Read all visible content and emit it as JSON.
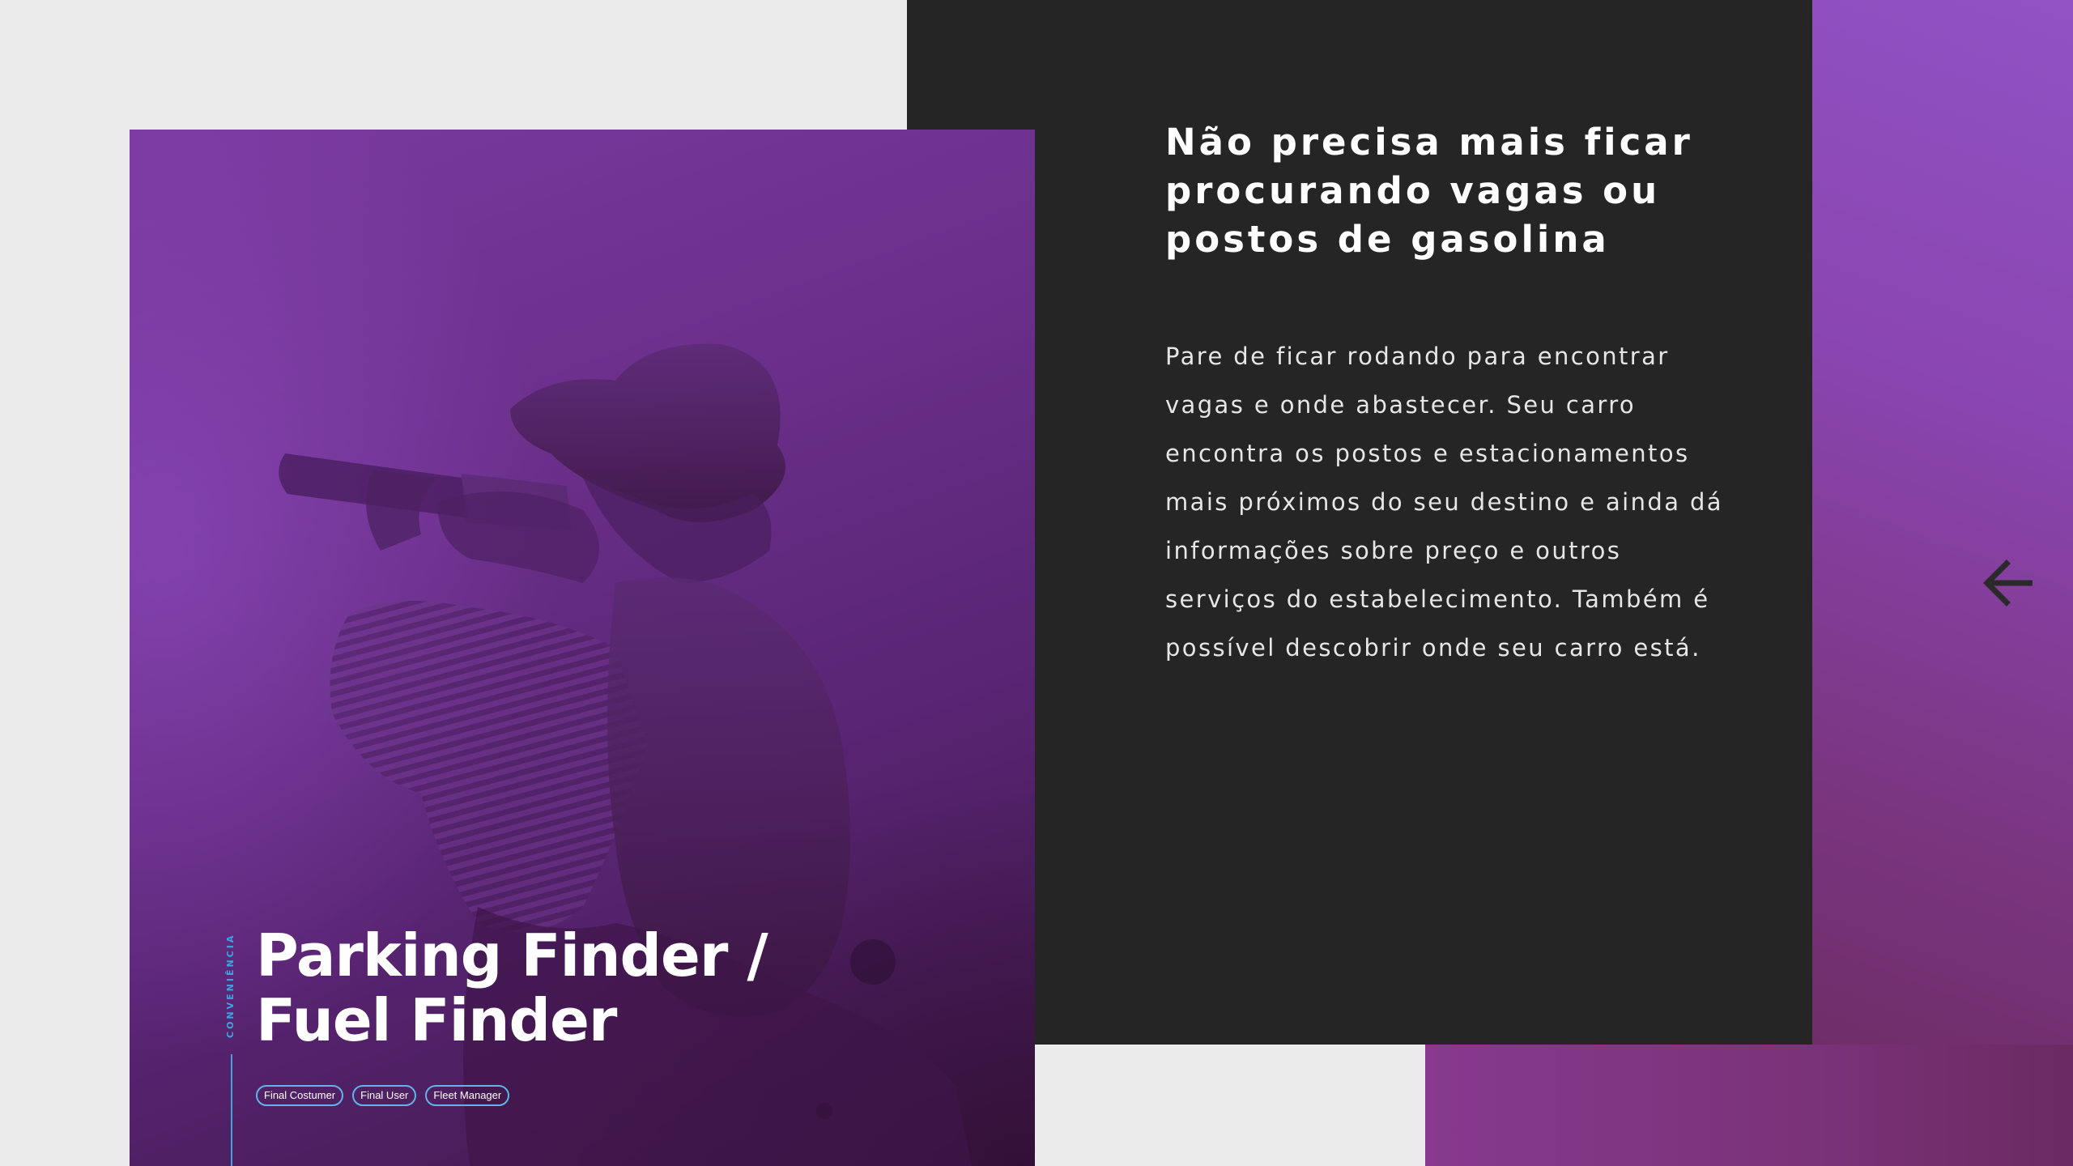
{
  "card": {
    "category": "CONVENIÊNCIA",
    "title_line1": "Parking Finder /",
    "title_line2": "Fuel Finder",
    "tags": [
      "Final Costumer",
      "Final User",
      "Fleet Manager"
    ]
  },
  "panel": {
    "headline": "Não precisa mais ficar procurando vagas ou postos de gasolina",
    "body": "Pare de ficar rodando para encontrar vagas e onde abastecer. Seu carro encontra os postos e estacionamentos mais próximos do seu destino e ainda dá informações sobre preço e outros serviços do estabelecimento. Também é possível descobrir onde seu carro está."
  },
  "navigation": {
    "back_icon": "arrow-left-icon"
  },
  "colors": {
    "background": "#ebebeb",
    "dark_panel": "#252525",
    "accent_blue": "#3aa6e0",
    "purple": "#7a3aa0"
  }
}
